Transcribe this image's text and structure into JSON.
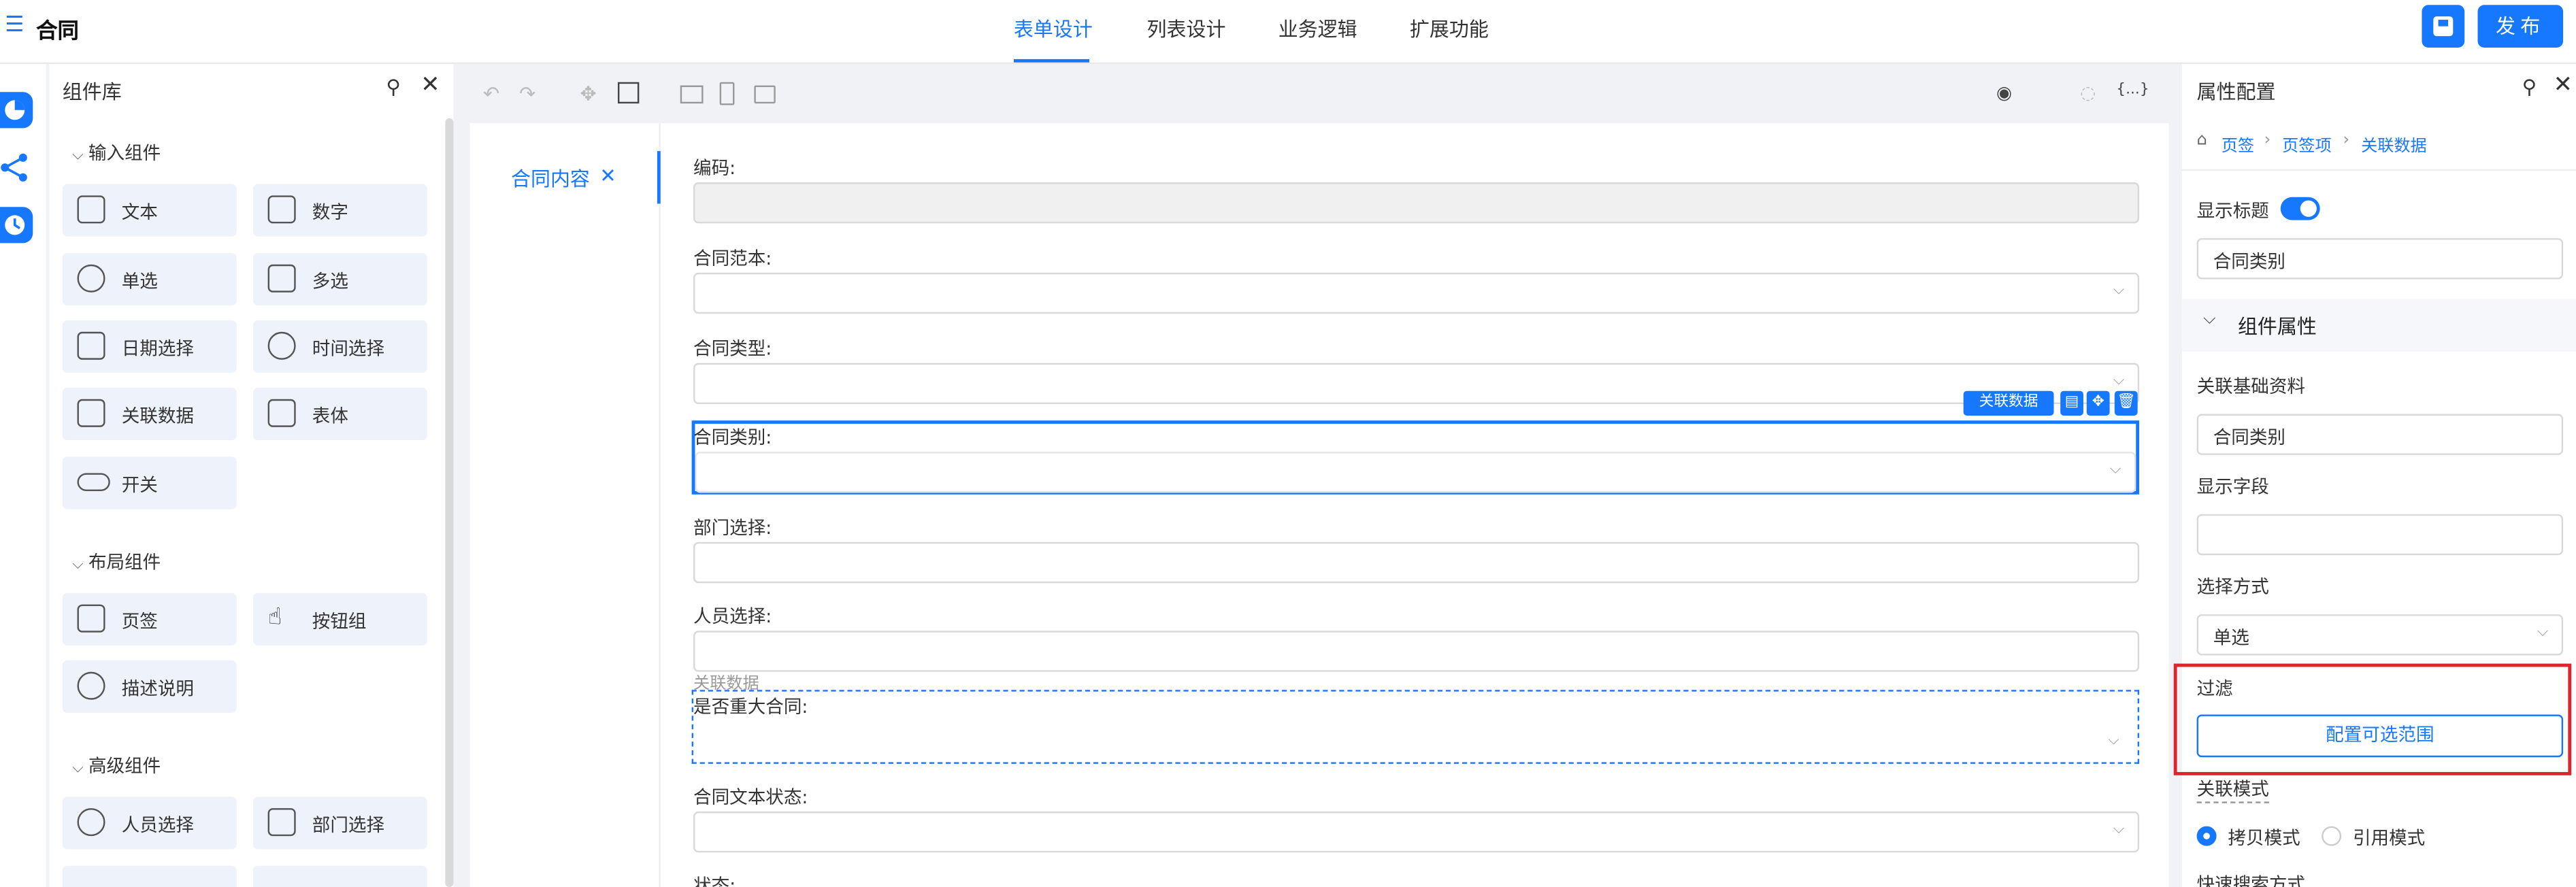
{
  "header": {
    "title": "合同",
    "tabs": [
      "表单设计",
      "列表设计",
      "业务逻辑",
      "扩展功能"
    ],
    "publish_label": "发布"
  },
  "library": {
    "title": "组件库",
    "groups": [
      {
        "title": "输入组件",
        "items": [
          "文本",
          "数字",
          "单选",
          "多选",
          "日期选择",
          "时间选择",
          "关联数据",
          "表体",
          "开关"
        ]
      },
      {
        "title": "布局组件",
        "items": [
          "页签",
          "按钮组",
          "描述说明"
        ]
      },
      {
        "title": "高级组件",
        "items": [
          "人员选择",
          "部门选择"
        ]
      }
    ]
  },
  "canvas": {
    "tab_label": "合同内容",
    "fields": [
      "编码:",
      "合同范本:",
      "合同类型:",
      "合同类别:",
      "部门选择:",
      "人员选择:",
      "是否重大合同:",
      "合同文本状态:",
      "状态:"
    ],
    "ghost_label": "关联数据",
    "badge_label": "关联数据"
  },
  "properties": {
    "title": "属性配置",
    "breadcrumb": [
      "页签",
      "页签项",
      "关联数据"
    ],
    "show_title_label": "显示标题",
    "title_value": "合同类别",
    "section_label": "组件属性",
    "base_data_label": "关联基础资料",
    "base_data_value": "合同类别",
    "display_field_label": "显示字段",
    "display_field_value": "",
    "select_mode_label": "选择方式",
    "select_mode_value": "单选",
    "filter_label": "过滤",
    "filter_button": "配置可选范围",
    "link_mode_label": "关联模式",
    "link_mode_options": [
      "拷贝模式",
      "引用模式"
    ],
    "quick_search_label": "快速搜索方式"
  }
}
